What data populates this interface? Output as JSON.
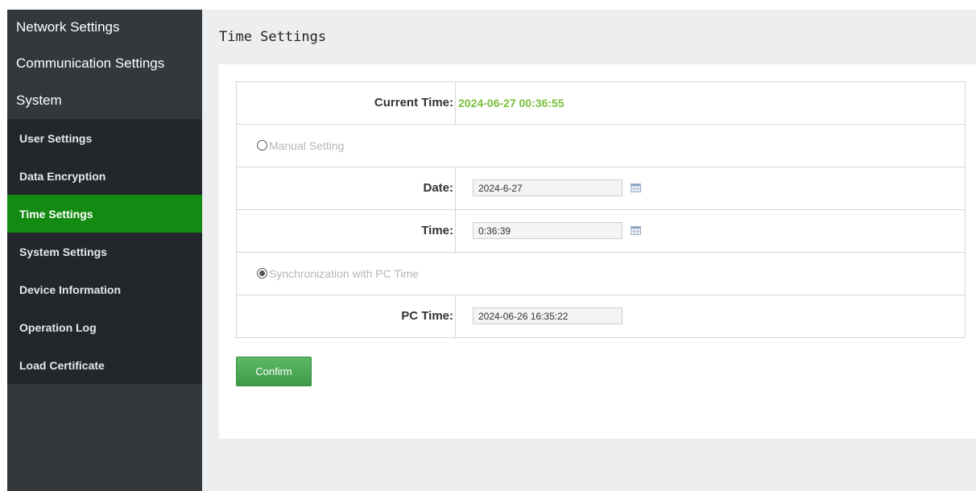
{
  "sidebar": {
    "top_items": [
      "Network Settings",
      "Communication Settings",
      "System"
    ],
    "sub_items": [
      {
        "label": "User Settings",
        "active": false
      },
      {
        "label": "Data Encryption",
        "active": false
      },
      {
        "label": "Time Settings",
        "active": true
      },
      {
        "label": "System Settings",
        "active": false
      },
      {
        "label": "Device Information",
        "active": false
      },
      {
        "label": "Operation Log",
        "active": false
      },
      {
        "label": "Load Certificate",
        "active": false
      }
    ]
  },
  "page": {
    "title": "Time Settings"
  },
  "form": {
    "current_time_label": "Current Time:",
    "current_time_value": "2024-06-27 00:36:55",
    "manual_setting_label": "Manual Setting",
    "manual_setting_checked": false,
    "date_label": "Date:",
    "date_value": "2024-6-27",
    "time_label": "Time:",
    "time_value": "0:36:39",
    "sync_pc_label": "Synchronization with PC Time",
    "sync_pc_checked": true,
    "pc_time_label": "PC Time:",
    "pc_time_value": "2024-06-26 16:35:22"
  },
  "buttons": {
    "confirm": "Confirm"
  },
  "colors": {
    "sidebar_bg": "#33383d",
    "submenu_bg": "#23272b",
    "active_item": "#138a11",
    "current_time_text": "#7bbf3a",
    "confirm_button": "#4caa55"
  },
  "icons": {
    "date_picker": "calendar-icon",
    "time_picker": "calendar-icon"
  }
}
